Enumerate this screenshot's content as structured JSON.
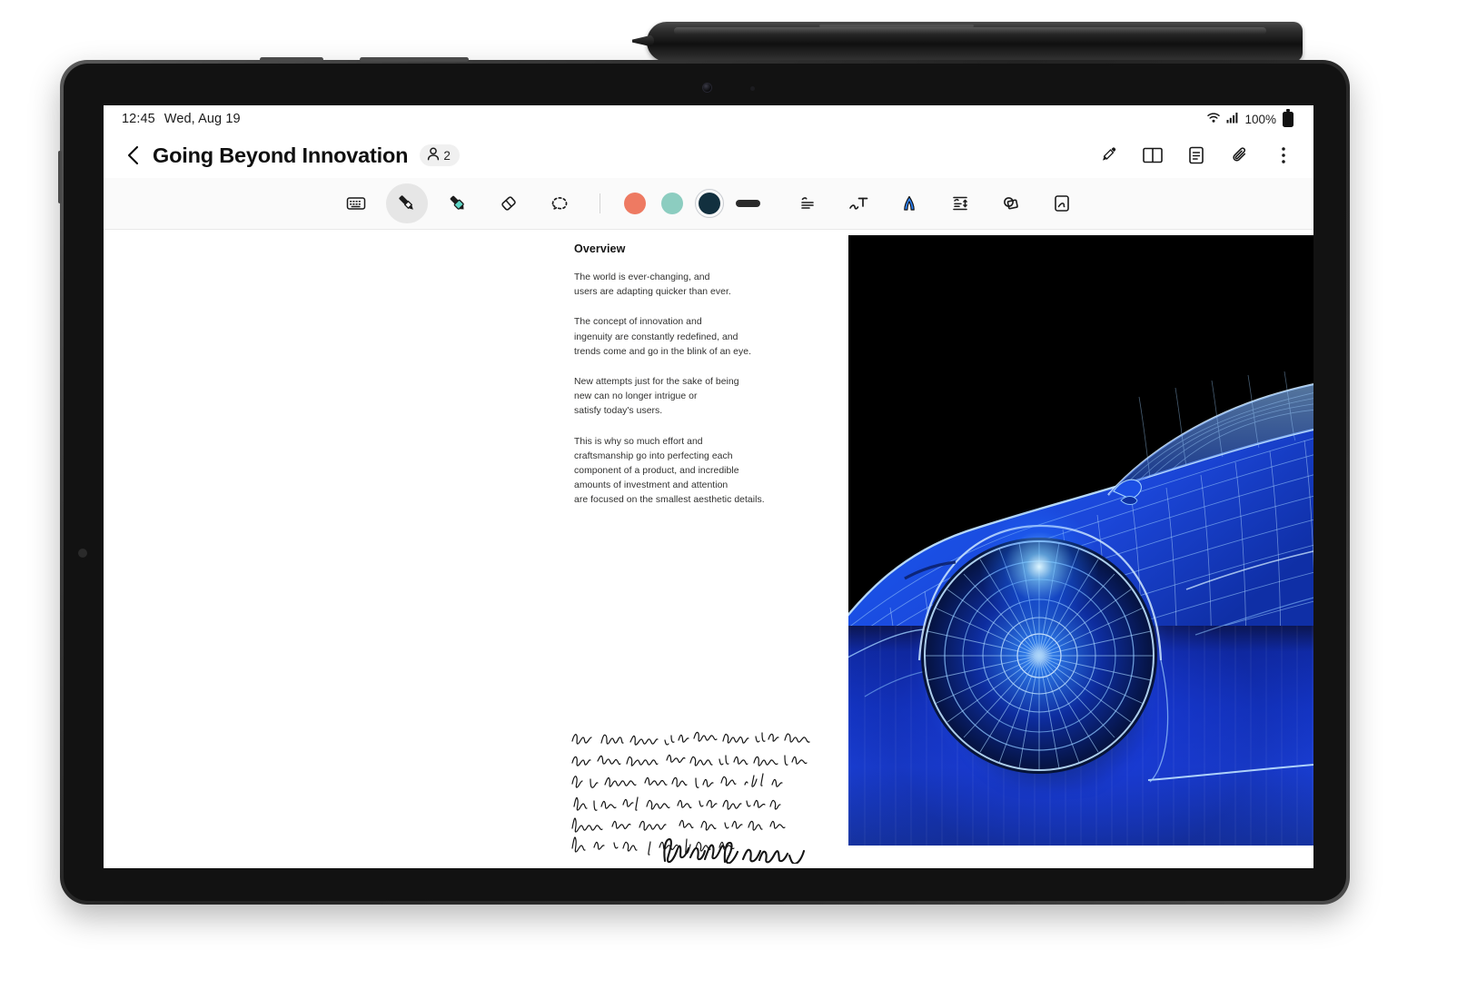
{
  "device": {
    "name": "Galaxy Tab S-series tablet",
    "stylus": "S Pen",
    "buttons": [
      "volume-rocker",
      "power-button"
    ]
  },
  "statusbar": {
    "time": "12:45",
    "date": "Wed, Aug 19",
    "wifi_icon": "wifi-icon",
    "signal_icon": "signal-bars-icon",
    "battery_percent": "100%",
    "battery_icon": "battery-full-icon"
  },
  "header": {
    "back_icon": "back-chevron-icon",
    "title": "Going Beyond Innovation",
    "collaborators": {
      "icon": "person-icon",
      "count": "2"
    },
    "actions": [
      {
        "name": "pen-select-icon",
        "label": "Pen settings"
      },
      {
        "name": "book-icon",
        "label": "Reading view"
      },
      {
        "name": "page-list-icon",
        "label": "Page view"
      },
      {
        "name": "paperclip-icon",
        "label": "Attachments"
      },
      {
        "name": "more-vertical-icon",
        "label": "More options"
      }
    ]
  },
  "toolbar": {
    "tools": [
      {
        "name": "keyboard-text-icon",
        "label": "Text / Keyboard",
        "selected": false
      },
      {
        "name": "pen-icon",
        "label": "Pen",
        "selected": true
      },
      {
        "name": "highlighter-icon",
        "label": "Highlighter",
        "selected": false
      },
      {
        "name": "eraser-icon",
        "label": "Eraser",
        "selected": false
      },
      {
        "name": "lasso-select-icon",
        "label": "Selection",
        "selected": false
      }
    ],
    "colors": [
      {
        "name": "color-coral",
        "hex": "#EE7A62",
        "selected": false
      },
      {
        "name": "color-mint",
        "hex": "#8CCDC0",
        "selected": false
      },
      {
        "name": "color-navy",
        "hex": "#12303F",
        "selected": true
      }
    ],
    "stroke": {
      "name": "stroke-width-pill",
      "hex": "#2B2B2B",
      "label": "Stroke width"
    },
    "right_tools": [
      {
        "name": "text-align-icon",
        "label": "Straighten text"
      },
      {
        "name": "convert-handwriting-icon",
        "label": "Convert handwriting to text"
      },
      {
        "name": "text-to-ink-icon",
        "label": "Ink to text",
        "accent": "#2E86FF"
      },
      {
        "name": "spacing-icon",
        "label": "Line spacing"
      },
      {
        "name": "shape-correct-icon",
        "label": "Shape correction"
      },
      {
        "name": "smart-write-icon",
        "label": "Smart write"
      }
    ]
  },
  "note": {
    "heading": "Overview",
    "paragraphs": [
      "The world is ever-changing, and\nusers are adapting quicker than ever.",
      "The concept of innovation and\ningenuity are constantly redefined, and\ntrends come and go in the blink of an eye.",
      "New attempts just for the sake of being\nnew can no longer intrigue or\nsatisfy today's users.",
      "This is why so much effort and\ncraftsmanship go into perfecting each\ncomponent of a product, and incredible\namounts of investment and attention\nare focused on the smallest aesthetic details."
    ],
    "handwriting": {
      "name": "handwritten-cursive-note",
      "description": "Cursive handwritten paragraph in dark ink with a signature flourish beneath"
    },
    "image": {
      "name": "wireframe-sports-car-image",
      "description": "Blue wireframe-rendered sports car on black background with a glowing blue floor reflection",
      "accent": "#1A3FD6"
    }
  }
}
